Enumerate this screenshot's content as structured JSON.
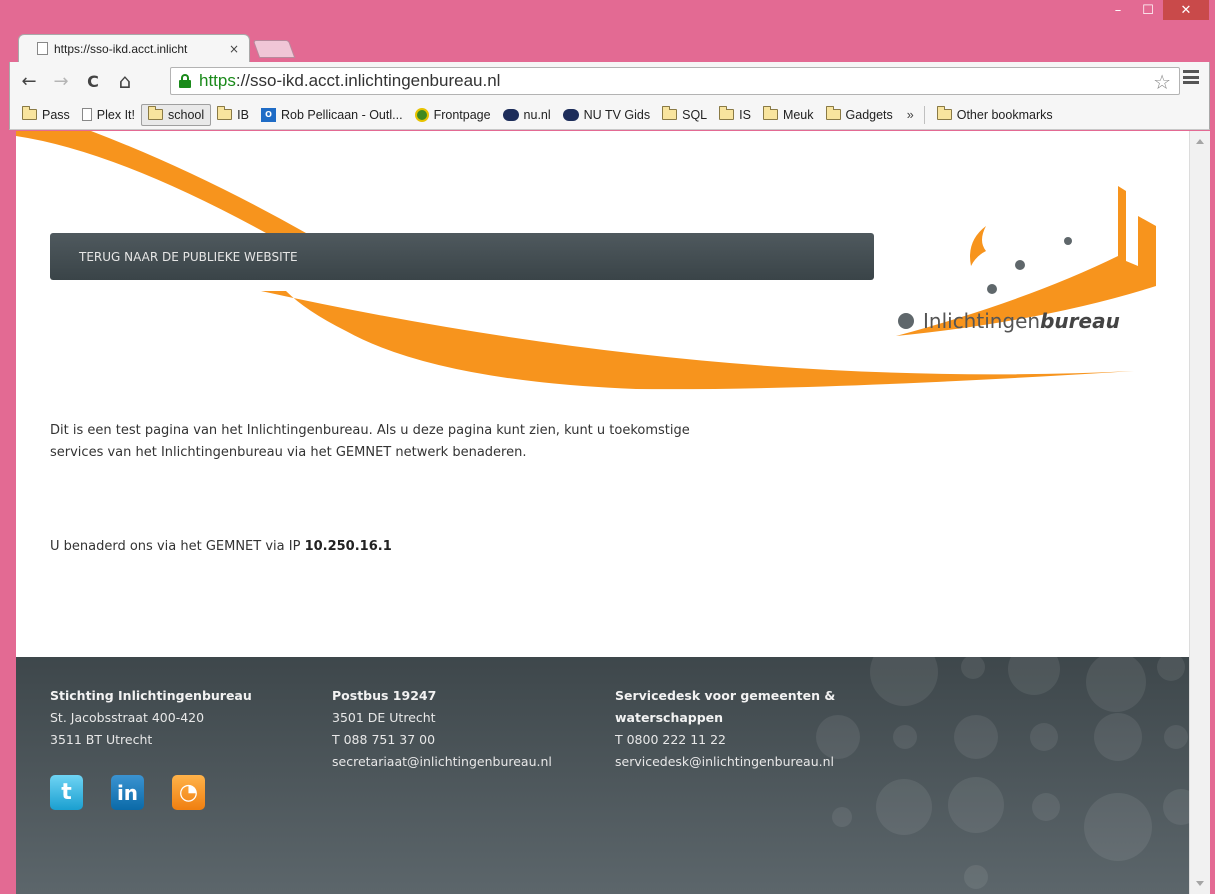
{
  "window": {
    "min_glyph": "–",
    "max_glyph": "☐",
    "close_glyph": "✕"
  },
  "tab": {
    "title": "https://sso-ikd.acct.inlicht",
    "close_glyph": "×"
  },
  "toolbar": {
    "back_glyph": "←",
    "forward_glyph": "→",
    "reload_glyph": "C",
    "home_glyph": "⌂",
    "url_scheme": "https",
    "url_rest": "://sso-ikd.acct.inlichtingenbureau.nl",
    "star_glyph": "☆"
  },
  "bookmarks": {
    "items": [
      "Pass",
      "Plex It!",
      "school",
      "IB",
      "Rob Pellicaan - Outl...",
      "Frontpage",
      "nu.nl",
      "NU TV Gids",
      "SQL",
      "IS",
      "Meuk",
      "Gadgets"
    ],
    "more": "»",
    "other": "Other bookmarks"
  },
  "page": {
    "back_button": "TERUG NAAR DE PUBLIEKE WEBSITE",
    "logo_text_plain": "Inlichtingen",
    "logo_text_bold": "bureau",
    "intro_line1": "Dit is een test pagina van het Inlichtingenbureau. Als u deze pagina kunt zien, kunt u toekomstige",
    "intro_line2": "services van het Inlichtingenbureau via het GEMNET netwerk benaderen.",
    "ip_prefix": "U benaderd ons via het GEMNET via IP ",
    "ip_value": "10.250.16.1"
  },
  "footer": {
    "col1": {
      "heading": "Stichting Inlichtingenbureau",
      "line1": "St. Jacobsstraat 400-420",
      "line2": "3511 BT Utrecht"
    },
    "col2": {
      "heading": "Postbus 19247",
      "line1": "3501 DE Utrecht",
      "line2": "T 088 751 37 00",
      "line3": "secretariaat@inlichtingenbureau.nl"
    },
    "col3": {
      "heading1": "Servicedesk voor gemeenten &",
      "heading2": "waterschappen",
      "line1": "T 0800 222 11 22",
      "line2": "servicedesk@inlichtingenbureau.nl"
    },
    "social": {
      "twitter": "t",
      "linkedin": "in",
      "rss": "◔"
    }
  },
  "colors": {
    "frame": "#e36a93",
    "accent_orange": "#f7941d",
    "footer_dark": "#3e474b"
  }
}
